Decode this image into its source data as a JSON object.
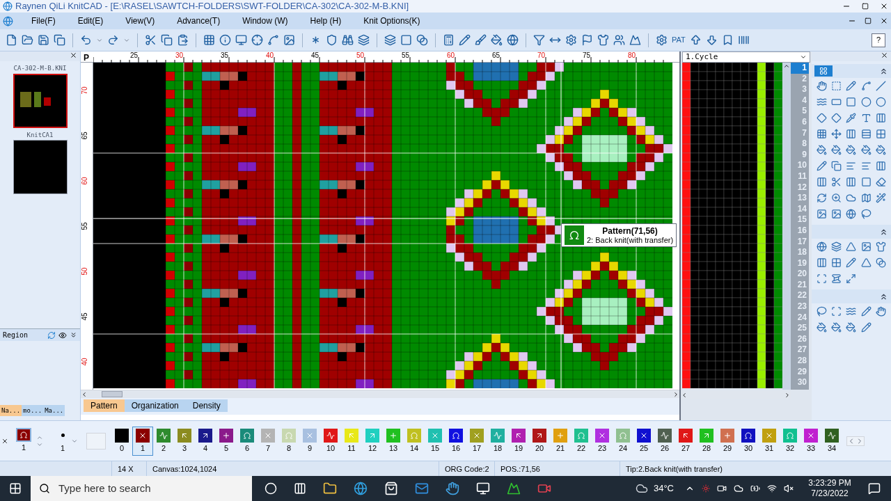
{
  "window": {
    "title": "Raynen QiLi KnitCAD - [E:\\RASEL\\SAWTCH-FOLDERS\\SWT-FOLDER\\CA-302\\CA-302-M-B.KNI]"
  },
  "menu": [
    "File(F)",
    "Edit(E)",
    "View(V)",
    "Advance(T)",
    "Window (W)",
    "Help (H)",
    "Knit Options(K)"
  ],
  "toolbar": {
    "pat_label": "PAT",
    "help": "?"
  },
  "files": [
    {
      "name": "CA-302-M-B.KNI",
      "selected": true
    },
    {
      "name": "KnitCA1",
      "selected": false
    }
  ],
  "region_label": "Region",
  "left_tabs": [
    {
      "label": "Na...",
      "selected": true
    },
    {
      "label": "mo...",
      "selected": false
    },
    {
      "label": "Ma...",
      "selected": false
    }
  ],
  "canvas": {
    "corner": "P",
    "top_ruler": [
      {
        "label": "25",
        "highlighted": false
      },
      {
        "label": "30",
        "highlighted": true
      },
      {
        "label": "35",
        "highlighted": false
      },
      {
        "label": "40",
        "highlighted": true
      },
      {
        "label": "45",
        "highlighted": false
      },
      {
        "label": "50",
        "highlighted": true
      },
      {
        "label": "55",
        "highlighted": false
      },
      {
        "label": "60",
        "highlighted": true
      },
      {
        "label": "65",
        "highlighted": false
      },
      {
        "label": "70",
        "highlighted": true
      },
      {
        "label": "75",
        "highlighted": false
      },
      {
        "label": "80",
        "highlighted": true
      }
    ],
    "side_ruler": [
      {
        "label": "70",
        "highlighted": true
      },
      {
        "label": "65",
        "highlighted": false
      },
      {
        "label": "60",
        "highlighted": true
      },
      {
        "label": "55",
        "highlighted": false
      },
      {
        "label": "50",
        "highlighted": true
      },
      {
        "label": "45",
        "highlighted": false
      },
      {
        "label": "40",
        "highlighted": true
      }
    ],
    "tabs": [
      {
        "label": "Pattern",
        "selected": true
      },
      {
        "label": "Organization",
        "selected": false
      },
      {
        "label": "Density",
        "selected": false
      }
    ],
    "tooltip": {
      "title": "Pattern(71,56)",
      "text": "2: Back knit(with transfer)"
    }
  },
  "cycle": {
    "dropdown": "1.Cycle",
    "rows": [
      {
        "label": "1",
        "selected": true
      },
      {
        "label": "2",
        "selected": false
      },
      {
        "label": "3",
        "selected": false
      },
      {
        "label": "4",
        "selected": false
      },
      {
        "label": "5",
        "selected": false
      },
      {
        "label": "6",
        "selected": false
      },
      {
        "label": "7",
        "selected": false
      },
      {
        "label": "8",
        "selected": false
      },
      {
        "label": "9",
        "selected": false
      },
      {
        "label": "10",
        "selected": false
      },
      {
        "label": "11",
        "selected": false
      },
      {
        "label": "12",
        "selected": false
      },
      {
        "label": "13",
        "selected": false
      },
      {
        "label": "14",
        "selected": false
      },
      {
        "label": "15",
        "selected": false
      },
      {
        "label": "16",
        "selected": false
      },
      {
        "label": "17",
        "selected": false
      },
      {
        "label": "18",
        "selected": false
      },
      {
        "label": "19",
        "selected": false
      },
      {
        "label": "20",
        "selected": false
      },
      {
        "label": "21",
        "selected": false
      },
      {
        "label": "22",
        "selected": false
      },
      {
        "label": "23",
        "selected": false
      },
      {
        "label": "24",
        "selected": false
      },
      {
        "label": "25",
        "selected": false
      },
      {
        "label": "26",
        "selected": false
      },
      {
        "label": "27",
        "selected": false
      },
      {
        "label": "28",
        "selected": false
      },
      {
        "label": "29",
        "selected": false
      },
      {
        "label": "30",
        "selected": false
      }
    ]
  },
  "stitch_bar": {
    "current": {
      "number": "1",
      "color": "#8b0000"
    },
    "size": "1",
    "stitches": [
      {
        "number": "0",
        "color": "#000000",
        "selected": false
      },
      {
        "number": "1",
        "color": "#8b0000",
        "selected": true
      },
      {
        "number": "2",
        "color": "#2e8b2e",
        "selected": false
      },
      {
        "number": "3",
        "color": "#8c8c20",
        "selected": false
      },
      {
        "number": "4",
        "color": "#1a1a8c",
        "selected": false
      },
      {
        "number": "5",
        "color": "#8b1a8b",
        "selected": false
      },
      {
        "number": "6",
        "color": "#1a8b7a",
        "selected": false
      },
      {
        "number": "7",
        "color": "#b4b4b4",
        "selected": false
      },
      {
        "number": "8",
        "color": "#c8d8b0",
        "selected": false
      },
      {
        "number": "9",
        "color": "#a8c0e0",
        "selected": false
      },
      {
        "number": "10",
        "color": "#e01818",
        "selected": false
      },
      {
        "number": "11",
        "color": "#e8e818",
        "selected": false
      },
      {
        "number": "12",
        "color": "#20d0c0",
        "selected": false
      },
      {
        "number": "13",
        "color": "#20c020",
        "selected": false
      },
      {
        "number": "14",
        "color": "#c0c020",
        "selected": false
      },
      {
        "number": "15",
        "color": "#20c0b0",
        "selected": false
      },
      {
        "number": "16",
        "color": "#1010e0",
        "selected": false
      },
      {
        "number": "17",
        "color": "#a0a020",
        "selected": false
      },
      {
        "number": "18",
        "color": "#20b0a0",
        "selected": false
      },
      {
        "number": "19",
        "color": "#b020b0",
        "selected": false
      },
      {
        "number": "20",
        "color": "#b01818",
        "selected": false
      },
      {
        "number": "21",
        "color": "#e0a010",
        "selected": false
      },
      {
        "number": "22",
        "color": "#20c090",
        "selected": false
      },
      {
        "number": "23",
        "color": "#b030e0",
        "selected": false
      },
      {
        "number": "24",
        "color": "#90c090",
        "selected": false
      },
      {
        "number": "25",
        "color": "#1010d0",
        "selected": false
      },
      {
        "number": "26",
        "color": "#506050",
        "selected": false
      },
      {
        "number": "27",
        "color": "#e01818",
        "selected": false
      },
      {
        "number": "28",
        "color": "#20c020",
        "selected": false
      },
      {
        "number": "29",
        "color": "#d07050",
        "selected": false
      },
      {
        "number": "30",
        "color": "#1010c0",
        "selected": false
      },
      {
        "number": "31",
        "color": "#c0a010",
        "selected": false
      },
      {
        "number": "32",
        "color": "#10c090",
        "selected": false
      },
      {
        "number": "33",
        "color": "#c020d0",
        "selected": false
      },
      {
        "number": "34",
        "color": "#306020",
        "selected": false
      }
    ]
  },
  "status_bar": [
    "14 X",
    "Canvas:1024,1024",
    "ORG Code:2",
    "POS.:71,56",
    "Tip:2.Back knit(with transfer)"
  ],
  "taskbar": {
    "search": {
      "placeholder": "Type here to search"
    },
    "weather": "34°C",
    "time": "3:23:29 PM",
    "date": "7/23/2022"
  }
}
